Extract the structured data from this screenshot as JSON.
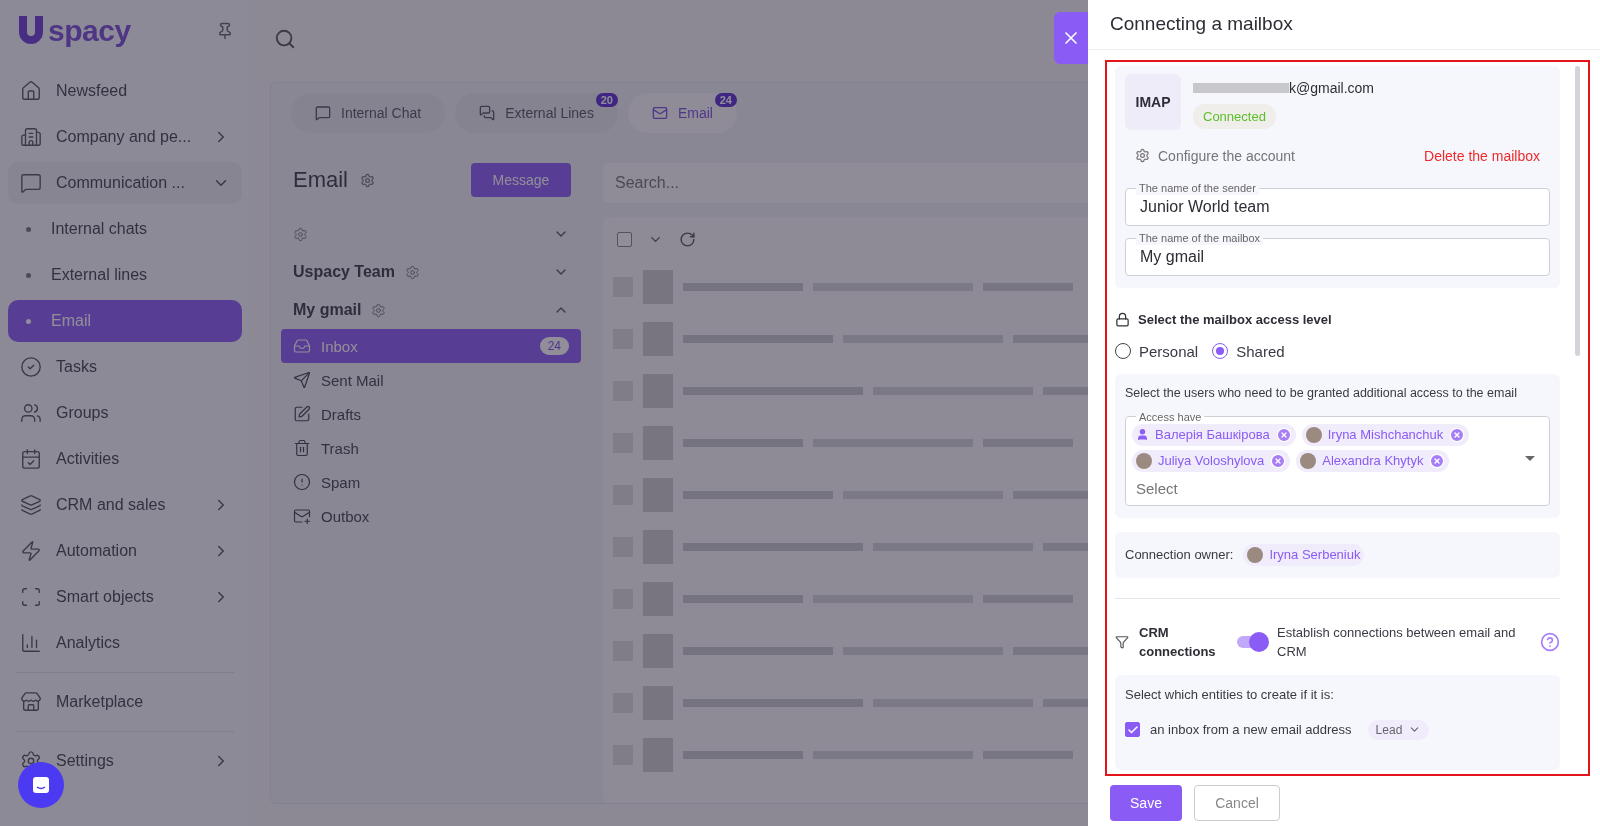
{
  "sidebar": {
    "logo": "spacy",
    "items": [
      {
        "label": "Newsfeed",
        "kind": "link",
        "selected": false
      },
      {
        "label": "Company and pe...",
        "kind": "group",
        "expanded": false,
        "selected": false
      },
      {
        "label": "Communication ...",
        "kind": "group",
        "expanded": true,
        "selected": false,
        "children": [
          {
            "label": "Internal chats",
            "selected": false
          },
          {
            "label": "External lines",
            "selected": false
          },
          {
            "label": "Email",
            "selected": true
          }
        ]
      },
      {
        "label": "Tasks",
        "kind": "link",
        "selected": false
      },
      {
        "label": "Groups",
        "kind": "link",
        "selected": false
      },
      {
        "label": "Activities",
        "kind": "link",
        "selected": false
      },
      {
        "label": "CRM and sales",
        "kind": "group",
        "expanded": false,
        "selected": false
      },
      {
        "label": "Automation",
        "kind": "group",
        "expanded": false,
        "selected": false
      },
      {
        "label": "Smart objects",
        "kind": "group",
        "expanded": false,
        "selected": false
      },
      {
        "label": "Analytics",
        "kind": "link",
        "selected": false
      },
      {
        "label": "Marketplace",
        "kind": "link",
        "selected": false,
        "divider_before": true
      },
      {
        "label": "Settings",
        "kind": "group",
        "expanded": false,
        "selected": false,
        "divider_before": true
      }
    ]
  },
  "tabs": [
    {
      "label": "Internal Chat",
      "selected": false
    },
    {
      "label": "External Lines",
      "badge": "20",
      "selected": false
    },
    {
      "label": "Email",
      "badge": "24",
      "selected": true
    }
  ],
  "mail": {
    "title": "Email",
    "compose": "Message",
    "accounts": [
      {
        "expanded": false
      },
      {
        "name": "Uspacy Team",
        "expanded": false
      },
      {
        "name": "My gmail",
        "expanded": true,
        "folders": [
          {
            "label": "Inbox",
            "count": "24",
            "selected": true
          },
          {
            "label": "Sent Mail",
            "selected": false
          },
          {
            "label": "Drafts",
            "selected": false
          },
          {
            "label": "Trash",
            "selected": false
          },
          {
            "label": "Spam",
            "selected": false
          },
          {
            "label": "Outbox",
            "selected": false
          }
        ]
      }
    ],
    "search": {
      "placeholder": "Search..."
    },
    "select_all": {
      "checked": false
    }
  },
  "drawer": {
    "title": "Connecting a mailbox",
    "account": {
      "protocol": "IMAP",
      "email": "k@gmail.com",
      "status": "Connected"
    },
    "configure_link": "Configure the account",
    "delete_link": "Delete the mailbox",
    "fields": [
      {
        "label": "The name of the sender",
        "value": "Junior World team"
      },
      {
        "label": "The name of the mailbox",
        "value": "My gmail"
      }
    ],
    "access": {
      "title": "Select the mailbox access level",
      "options": [
        {
          "label": "Personal",
          "selected": false
        },
        {
          "label": "Shared",
          "selected": true
        }
      ]
    },
    "users": {
      "hint": "Select the users who need to be granted additional access to the email",
      "label": "Access have",
      "placeholder": "Select",
      "chips": [
        {
          "name": "Валерія Башкірова",
          "kind": "icon"
        },
        {
          "name": "Iryna Mishchanchuk",
          "kind": "photo"
        },
        {
          "name": "Juliya Voloshylova",
          "kind": "photo"
        },
        {
          "name": "Alexandra Khytyk",
          "kind": "photo"
        }
      ]
    },
    "owner": {
      "label": "Connection owner:",
      "name": "Iryna Serbeniuk"
    },
    "crm": {
      "title": "CRM connections",
      "on": true,
      "description": "Establish connections between email and CRM"
    },
    "entities": {
      "title": "Select which entities to create if it is:",
      "rows": [
        {
          "label": "an inbox from a new email address",
          "checked": true,
          "entity": "Lead"
        }
      ]
    },
    "save": "Save",
    "cancel": "Cancel"
  }
}
